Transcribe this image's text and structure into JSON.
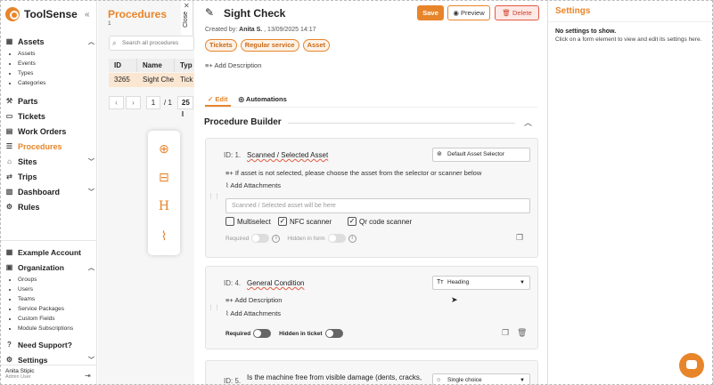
{
  "app": {
    "name": "ToolSense"
  },
  "sidebar": {
    "sections": [
      {
        "label": "Assets",
        "icon": "grid-icon",
        "subitems": [
          "Assets",
          "Events",
          "Types",
          "Categories"
        ]
      },
      {
        "label": "Parts",
        "icon": "parts-icon"
      },
      {
        "label": "Tickets",
        "icon": "tickets-icon"
      },
      {
        "label": "Work Orders",
        "icon": "work-orders-icon"
      },
      {
        "label": "Procedures",
        "icon": "procedures-icon",
        "active": true
      },
      {
        "label": "Sites",
        "icon": "sites-icon"
      },
      {
        "label": "Trips",
        "icon": "trips-icon"
      },
      {
        "label": "Dashboard",
        "icon": "dashboard-icon"
      },
      {
        "label": "Rules",
        "icon": "rules-icon"
      }
    ],
    "bottom": [
      {
        "label": "Example Account",
        "icon": "building-icon"
      },
      {
        "label": "Organization",
        "icon": "organization-icon",
        "subitems": [
          "Groups",
          "Users",
          "Teams",
          "Service Packages",
          "Custom Fields",
          "Module Subscriptions"
        ]
      },
      {
        "label": "Need Support?",
        "icon": "help-icon"
      },
      {
        "label": "Settings",
        "icon": "gear-icon"
      }
    ],
    "user": {
      "name": "Anita Stipic",
      "role": "Admin User"
    }
  },
  "list": {
    "title": "Procedures",
    "count": "1",
    "search_placeholder": "Search all procedures",
    "columns": [
      "ID",
      "Name",
      "Typ"
    ],
    "row": [
      "3265",
      "Sight Che",
      "Tick"
    ],
    "page": "1",
    "pages": "/ 1",
    "page_size": "25 l"
  },
  "close_label": "Close",
  "editor": {
    "title": "Sight Check",
    "save": "Save",
    "preview": "Preview",
    "delete": "Delete",
    "created_prefix": "Created by:",
    "created_by": "Anita S.",
    "created_date": ", 13/09/2025 14:17",
    "tags": [
      "Tickets",
      "Regular service",
      "Asset"
    ],
    "add_description": "Add Description",
    "tabs": [
      "Edit",
      "Automations"
    ],
    "builder_title": "Procedure Builder",
    "cards": [
      {
        "id": "ID: 1.",
        "name": "Scanned / Selected Asset",
        "selector": "Default Asset Selector",
        "description": "If asset is not selected, please choose the asset from the selector or scanner below",
        "attachments": "Add Attachments",
        "input_placeholder": "Scanned / Selected asset will be here",
        "checks": [
          {
            "label": "Multiselect",
            "checked": false
          },
          {
            "label": "NFC scanner",
            "checked": true
          },
          {
            "label": "Qr code scanner",
            "checked": true
          }
        ],
        "required": "Required",
        "hidden": "Hidden in form"
      },
      {
        "id": "ID: 4.",
        "name": "General Condition",
        "selector": "Heading",
        "description": "Add Description",
        "attachments": "Add Attachments",
        "required": "Required",
        "hidden": "Hidden in ticket"
      },
      {
        "id": "ID: 5.",
        "name": "Is the machine free from visible damage (dents, cracks,",
        "selector": "Single choice"
      }
    ]
  },
  "settings": {
    "title": "Settings",
    "heading": "No settings to show.",
    "text": "Click on a form element to view and edit its settings here."
  },
  "colors": {
    "accent": "#e8852a",
    "danger": "#e25b45"
  }
}
